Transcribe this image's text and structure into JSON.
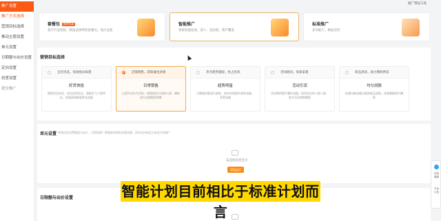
{
  "sidebar": {
    "items": [
      {
        "label": "推广设置",
        "state": "active"
      },
      {
        "label": "推广方式选择",
        "state": "orange"
      },
      {
        "label": "营销目标选择",
        "state": "normal"
      },
      {
        "label": "推动主题设置",
        "state": "normal"
      },
      {
        "label": "单元设置",
        "state": "normal"
      },
      {
        "label": "日期额与出价设置",
        "state": "normal"
      },
      {
        "label": "定向设置",
        "state": "normal"
      },
      {
        "label": "创意设置",
        "state": "normal"
      },
      {
        "label": "提交推广",
        "state": "muted"
      }
    ]
  },
  "header": {
    "top_right": "推广预设工具"
  },
  "top_cards": [
    {
      "title": "套餐包",
      "badge": "限时优惠",
      "desc": "基于行业经验，精准选择特色套餐包，低价全能",
      "selected": false
    },
    {
      "title": "智能推广",
      "badge": "",
      "desc": "系统智能投放，适人、选创意，帮产覆盖",
      "selected": true
    },
    {
      "title": "标准推广",
      "badge": "",
      "desc": "多功能工，精准可控",
      "selected": false
    }
  ],
  "goal_section": {
    "title": "营销目标选择",
    "cards": [
      {
        "tag": "全店优选，快速拖动拿量",
        "name": "好货快投",
        "desc": "围绕货品的优、定位优质货品，智能学习人群特征，快速获取精准转化流量",
        "selected": false
      },
      {
        "tag": "店铺销售，获取展位效果",
        "name": "日常销售",
        "desc": "以提升成交为目标，按照商品引流和人群，辅助成为长期稳定销售",
        "selected": true
      },
      {
        "tag": "热点趋势捕捉，抢占先机",
        "name": "趋势明星",
        "desc": "大数据挖掘流行趋势，抢先布局提升趋势流量，享受流量",
        "selected": false
      },
      {
        "tag": "活动期间，快速拿量",
        "name": "活动引流",
        "desc": "活动期间提升曝光流量，抢用关注的人群人群，助力活动销售爆发",
        "selected": false
      },
      {
        "tag": "新品测试，助力爆款养成",
        "name": "均匀测款",
        "desc": "快速均衡流量分配给新品测款，快速掌握潜力爆款",
        "selected": false
      }
    ]
  },
  "unit_section": {
    "title": "单元设置",
    "hint": "单独设定消费额度与出价，可帮助推广更精准地获取关键流量，同时支持新品与老品分别推广",
    "empty_text": "未选择任何宝贝",
    "button_label": "添加宝贝"
  },
  "budget_section": {
    "title": "日限额与出价设置"
  },
  "float_panel": {
    "line1": "在线",
    "line2": "客服",
    "line3": "平台",
    "line4": "公告"
  },
  "subtitle": "智能计划目前相比于标准计划而言",
  "colors": {
    "accent": "#fa5a13",
    "button": "#fa8c16",
    "subtitle_bg": "#ffd800"
  }
}
